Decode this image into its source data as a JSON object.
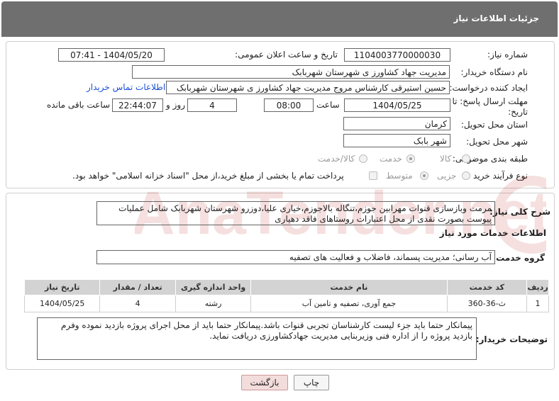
{
  "header": {
    "title": "جزئیات اطلاعات نیاز"
  },
  "form": {
    "need_number_label": "شماره نیاز:",
    "need_number": "1104003770000030",
    "announce_label": "تاریخ و ساعت اعلان عمومی:",
    "announce_value": "1404/05/20 - 07:41",
    "buyer_org_label": "نام دستگاه خریدار:",
    "buyer_org": "مدیریت جهاد کشاورز ی شهرستان شهربابک",
    "creator_label": "ایجاد کننده درخواست:",
    "creator": "حسین استیرقی کارشناس مروج مدیریت جهاد کشاورز ی شهرستان شهربابک",
    "contact_link": "اطلاعات تماس خریدار",
    "deadline_label_1": "مهلت ارسال پاسخ: تا",
    "deadline_label_2": "تاریخ:",
    "deadline_date": "1404/05/25",
    "time_label": "ساعت",
    "deadline_time": "08:00",
    "days_value": "4",
    "days_label": "روز و",
    "remaining_time": "22:44:07",
    "remaining_label": "ساعت باقی مانده",
    "province_label": "استان محل تحویل:",
    "province": "کرمان",
    "city_label": "شهر محل تحویل:",
    "city": "شهر بابک",
    "category_label": "طبقه بندی موضوعی:",
    "category_options": [
      "کالا",
      "خدمت",
      "کالا/خدمت"
    ],
    "category_selected": "خدمت",
    "process_label": "نوع فرآیند خرید :",
    "process_options": [
      "جزیی",
      "متوسط"
    ],
    "process_selected": "متوسط",
    "payment_note": "پرداخت تمام یا بخشی از مبلغ خرید،از محل \"اسناد خزانه اسلامی\" خواهد بود."
  },
  "summary": {
    "label": "شرح کلی نیاز:",
    "text": "مرمت وبازسازی قنوات مهرابین جوزم،تنگاله بالاجوزم،خیاری علیا،دوزرو شهرستان شهربابک شامل عملیات پیوست بصورت نقدی از محل اعتبارات روستاهای فاقد دهیاری"
  },
  "services": {
    "section_title": "اطلاعات خدمات مورد نیاز",
    "group_label": "گروه خدمت:",
    "group_value": "آب رسانی؛ مدیریت پسماند، فاضلاب و فعالیت های تصفیه",
    "columns": [
      "ردیف",
      "کد خدمت",
      "نام خدمت",
      "واحد اندازه گیری",
      "تعداد / مقدار",
      "تاریخ نیاز"
    ],
    "rows": [
      [
        "1",
        "ث-36-360",
        "جمع آوری، تصفیه و تامین آب",
        "رشته",
        "4",
        "1404/05/25"
      ]
    ]
  },
  "buyer_notes": {
    "label": "توضیحات خریدار:",
    "text": "پیمانکار حتما باید جزء لیست کارشناسان تجربی قنوات باشد.پیمانکار حتما باید از محل اجرای پروژه بازدید نموده وفرم بازدید پروژه را از اداره فنی وزیربنایی مدیریت جهادکشاورزی دریافت نماید."
  },
  "buttons": {
    "print": "چاپ",
    "back": "بازگشت"
  },
  "watermark": {
    "text": "AnaTender.net"
  }
}
